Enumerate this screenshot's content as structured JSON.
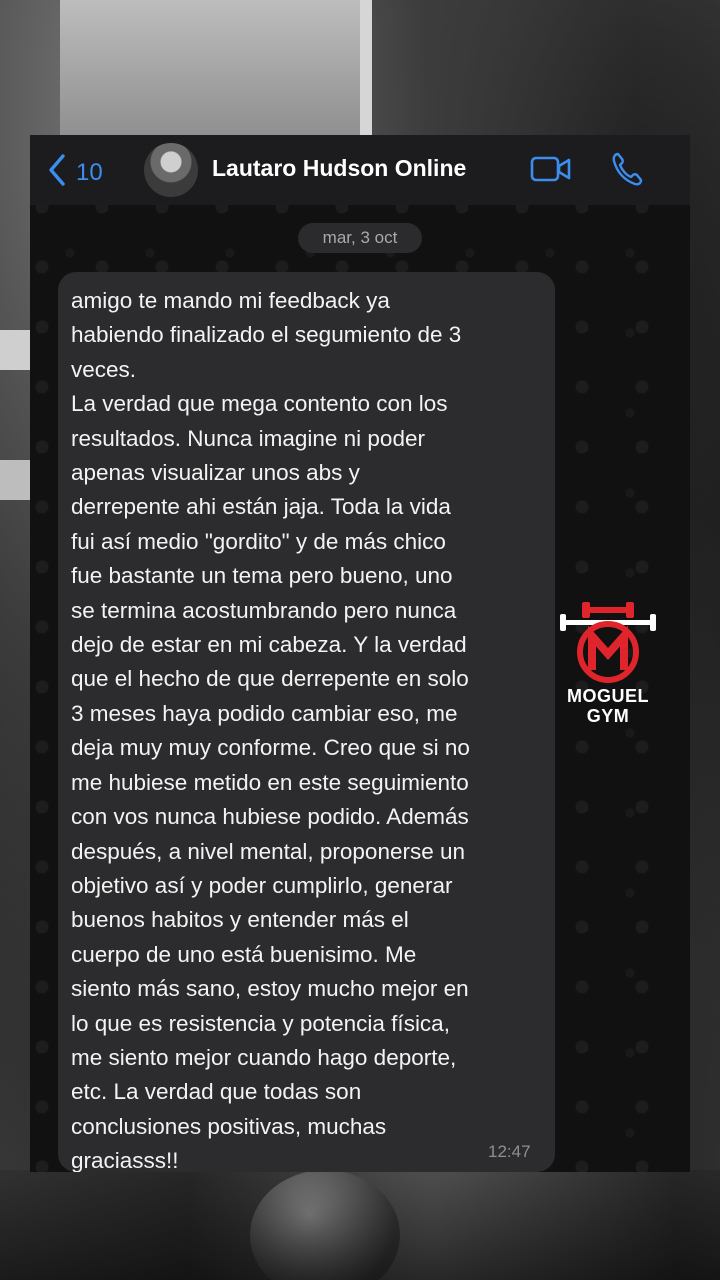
{
  "header": {
    "back_count": "10",
    "contact_name": "Lautaro Hudson Online"
  },
  "date_label": "mar, 3 oct",
  "message": {
    "text": "amigo te mando mi feedback ya\nhabiendo finalizado el segumiento de 3\nveces.\nLa verdad que mega contento con los\nresultados. Nunca imagine ni poder\napenas visualizar unos abs y\nderrepente ahi están jaja. Toda la vida\nfui así medio \"gordito\" y de más chico\nfue bastante un tema pero bueno, uno\nse termina acostumbrando pero nunca\ndejo de estar en mi cabeza. Y la verdad\nque el hecho de que derrepente en solo\n3 meses haya podido cambiar eso, me\ndeja muy muy conforme. Creo que si no\nme hubiese metido en este seguimiento\ncon vos nunca hubiese podido. Además\ndespués, a nivel mental, proponerse un\nobjetivo así y poder cumplirlo, generar\nbuenos habitos y entender más el\ncuerpo de uno está buenisimo. Me\nsiento más sano, estoy mucho mejor en\nlo que es resistencia y potencia física,\nme siento mejor cuando hago deporte,\netc. La verdad que todas son\nconclusiones positivas, muchas\ngraciasss!!",
    "time": "12:47"
  },
  "logo": {
    "line1": "MOGUEL",
    "line2": "GYM"
  },
  "colors": {
    "accent": "#3b8ef0",
    "bubble": "#2c2c2e",
    "logo_red": "#e0242b"
  },
  "icons": [
    "chevron-left-icon",
    "video-call-icon",
    "phone-call-icon"
  ]
}
